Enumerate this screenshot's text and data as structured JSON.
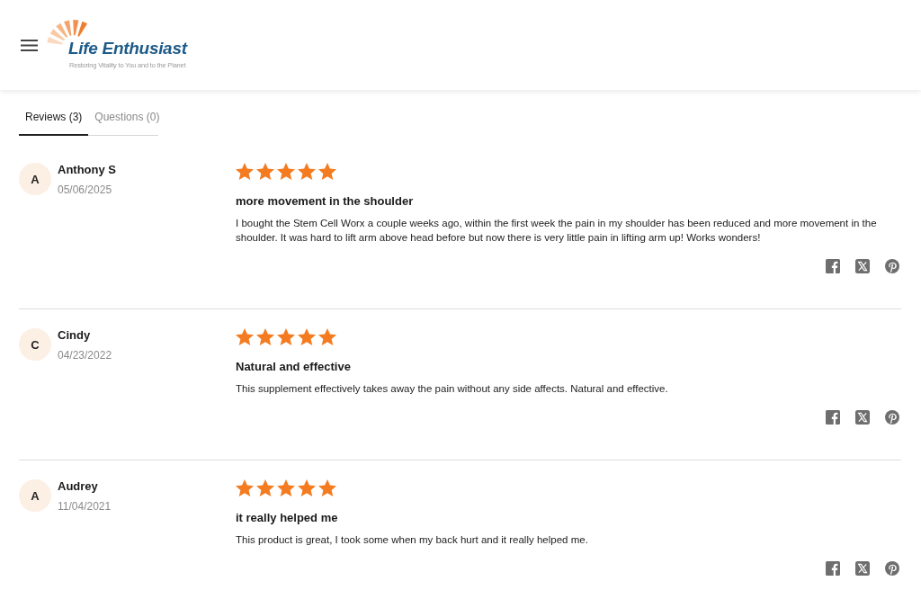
{
  "header": {
    "brand": "Life Enthusiast",
    "tagline": "Restoring Vitality to You and to the Planet"
  },
  "tabs": [
    {
      "label": "Reviews (3)",
      "selected": true
    },
    {
      "label": "Questions (0)",
      "selected": false
    }
  ],
  "reviews": [
    {
      "initial": "A",
      "name": "Anthony S",
      "date": "05/06/2025",
      "stars": 5,
      "title": "more movement in the shoulder",
      "body": "I bought the Stem Cell Worx a couple weeks ago, within the first week the pain in my shoulder has been reduced and more movement in the shoulder. It was hard to lift arm above head before but now there is very little pain in lifting arm up! Works wonders!"
    },
    {
      "initial": "C",
      "name": "Cindy",
      "date": "04/23/2022",
      "stars": 5,
      "title": "Natural and effective",
      "body": "This supplement effectively takes away the pain without any side affects. Natural and effective."
    },
    {
      "initial": "A",
      "name": "Audrey",
      "date": "11/04/2021",
      "stars": 5,
      "title": "it really helped me",
      "body": "This product is great, I took some when my back hurt and it really helped me."
    }
  ]
}
